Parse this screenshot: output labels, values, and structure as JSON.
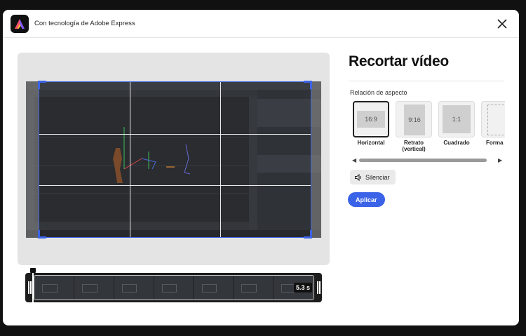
{
  "header": {
    "title": "Con tecnología de Adobe Express",
    "logo_icon": "adobe-express-logo",
    "close_icon": "close-icon"
  },
  "panel": {
    "title": "Recortar vídeo",
    "aspect_label": "Relación de aspecto",
    "ratios": [
      {
        "value": "16:9",
        "name": "Horizontal",
        "selected": true
      },
      {
        "value": "9:16",
        "name": "Retrato (vertical)",
        "name_line1": "Retrato",
        "name_line2": "(vertical)",
        "selected": false
      },
      {
        "value": "1:1",
        "name": "Cuadrado",
        "selected": false
      },
      {
        "value": "",
        "name": "Forma libre",
        "selected": false
      }
    ],
    "mute_label": "Silenciar",
    "mute_icon": "speaker-icon",
    "apply_label": "Aplicar"
  },
  "timeline": {
    "duration": "5.3 s"
  },
  "colors": {
    "accent": "#3b63e8",
    "dark": "#1d1d1d"
  }
}
